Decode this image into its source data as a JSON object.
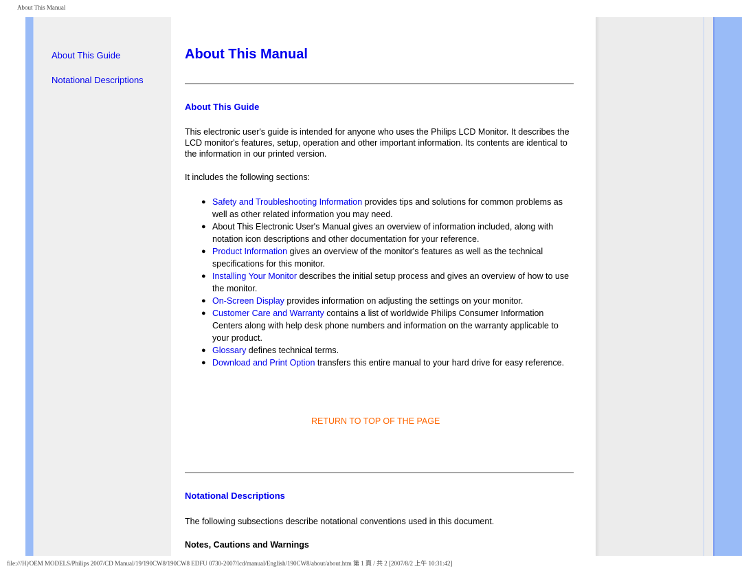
{
  "print_header": "About This Manual",
  "print_footer": "file:///H|/OEM MODELS/Philips 2007/CD Manual/19/190CW8/190CW8 EDFU 0730-2007/lcd/manual/English/190CW8/about/about.htm 第 1 頁 / 共 2 [2007/8/2 上午 10:31:42]",
  "colors": {
    "link": "#0000ee",
    "return_link": "#ff6600",
    "sidebar_stripe": "#99bbf7",
    "panel_bg": "#efefef"
  },
  "sidebar": {
    "items": [
      {
        "label": "About This Guide"
      },
      {
        "label": "Notational Descriptions"
      }
    ]
  },
  "main": {
    "title": "About This Manual",
    "about_guide": {
      "heading": "About This Guide",
      "intro": "This electronic user's guide is intended for anyone who uses the Philips LCD Monitor. It describes the LCD monitor's features, setup, operation and other important information. Its contents are identical to the information in our printed version.",
      "includes": "It includes the following sections:",
      "bullet_glyph": "●",
      "sections": [
        {
          "link": "Safety and Troubleshooting Information",
          "text": " provides tips and solutions for common problems as well as other related information you may need."
        },
        {
          "link": "",
          "text": "About This Electronic User's Manual gives an overview of information included, along with notation icon descriptions and other documentation for your reference."
        },
        {
          "link": "Product Information",
          "text": " gives an overview of the monitor's features as well as the technical specifications for this monitor."
        },
        {
          "link": "Installing Your Monitor",
          "text": " describes the initial setup process and gives an overview of how to use the monitor."
        },
        {
          "link": "On-Screen Display",
          "text": " provides information on adjusting the settings on your monitor."
        },
        {
          "link": "Customer Care and Warranty",
          "text": " contains a list of worldwide Philips Consumer Information Centers along with help desk phone numbers and information on the warranty applicable to your product."
        },
        {
          "link": "Glossary",
          "text": " defines technical terms."
        },
        {
          "link": "Download and Print Option",
          "text": " transfers this entire manual to your hard drive for easy reference."
        }
      ]
    },
    "return_to_top": "RETURN TO TOP OF THE PAGE",
    "notational": {
      "heading": "Notational Descriptions",
      "intro": "The following subsections describe notational conventions used in this document.",
      "subheading": "Notes, Cautions and Warnings"
    }
  }
}
